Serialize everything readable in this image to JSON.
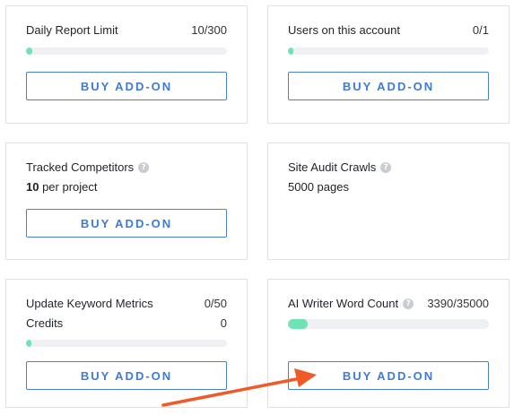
{
  "cards": [
    {
      "title": "Daily Report Limit",
      "count": "10/300",
      "progress": 0.033,
      "button": "BUY ADD-ON"
    },
    {
      "title": "Users on this account",
      "count": "0/1",
      "progress": 0,
      "button": "BUY ADD-ON"
    },
    {
      "title": "Tracked Competitors",
      "help_icon": "?",
      "sub_bold": "10",
      "sub_rest": " per project",
      "button": "BUY ADD-ON"
    },
    {
      "title": "Site Audit Crawls",
      "help_icon": "?",
      "sub": "5000 pages"
    },
    {
      "title": "Update Keyword Metrics",
      "count": "0/50",
      "line2_label": "Credits",
      "line2_value": "0",
      "progress": 0,
      "button": "BUY ADD-ON"
    },
    {
      "title": "AI Writer Word Count",
      "help_icon": "?",
      "count": "3390/35000",
      "progress": 0.097,
      "button": "BUY ADD-ON"
    }
  ],
  "colors": {
    "accent": "#3f7ad6",
    "progress_fill": "#6fe3b3",
    "progress_track": "#eef0f3",
    "arrow": "#f05a28"
  },
  "annotation": {
    "icon": "arrow-pointing-to-buy-add-on-button"
  }
}
